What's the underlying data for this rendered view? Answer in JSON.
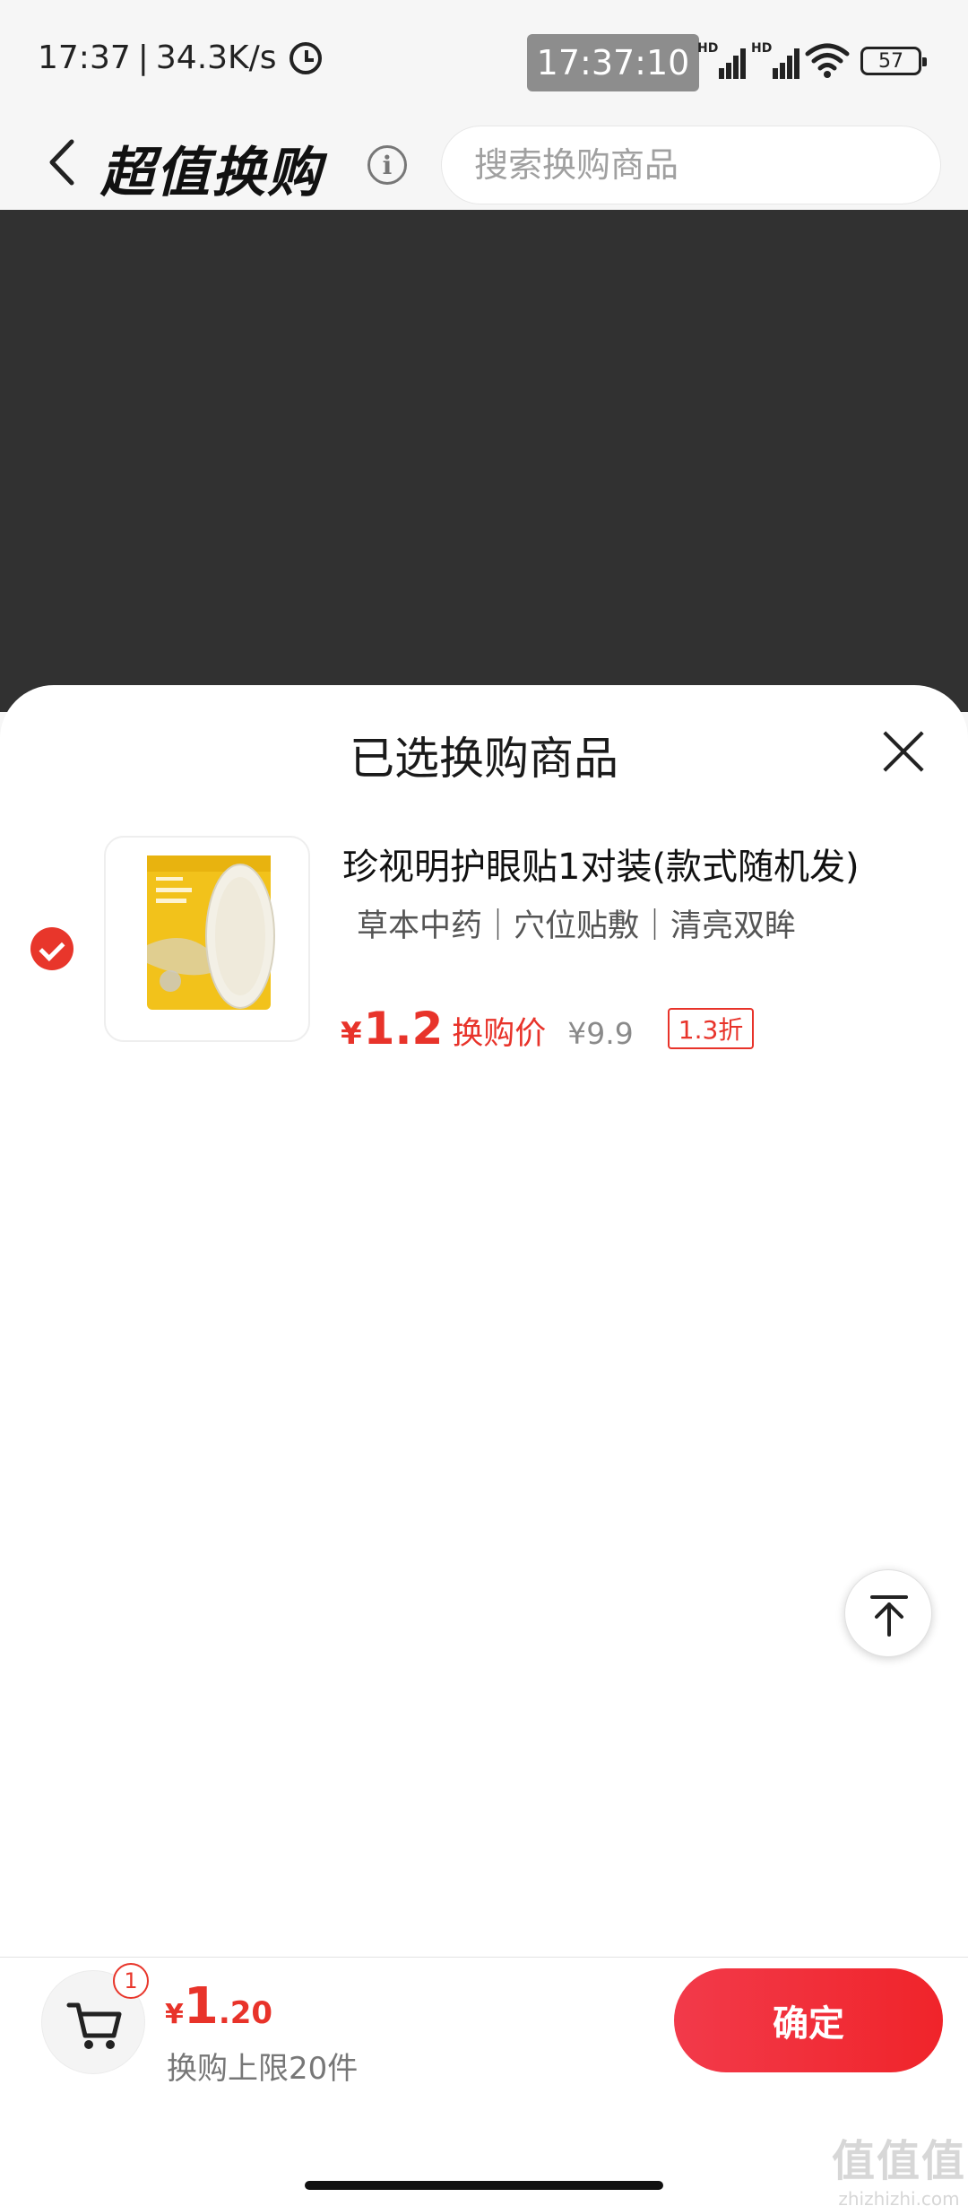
{
  "status_bar": {
    "time": "17:37",
    "net_speed": "34.3K/s",
    "clock_overlay": "17:37:10",
    "signal_label_1": "HD",
    "signal_label_2": "HD",
    "battery": "57"
  },
  "nav": {
    "title": "超值换购",
    "search_placeholder": "搜索换购商品"
  },
  "sheet": {
    "title": "已选换购商品",
    "product": {
      "name": "珍视明护眼贴1对装(款式随机发)",
      "tags": "草本中药｜穴位贴敷｜清亮双眸",
      "currency": "¥",
      "price": "1.2",
      "price_label": "换购价",
      "original_price": "¥9.9",
      "discount": "1.3折",
      "selected": true
    }
  },
  "footer": {
    "cart_count": "1",
    "total_currency": "¥",
    "total_int": "1",
    "total_dec": ".20",
    "limit_text": "换购上限20件",
    "confirm_label": "确定"
  },
  "watermark": {
    "logo": "值值值",
    "url": "zhizhizhi.com"
  },
  "colors": {
    "accent": "#e8332a",
    "overlay": "#313131",
    "product_yellow": "#f2c21b"
  }
}
